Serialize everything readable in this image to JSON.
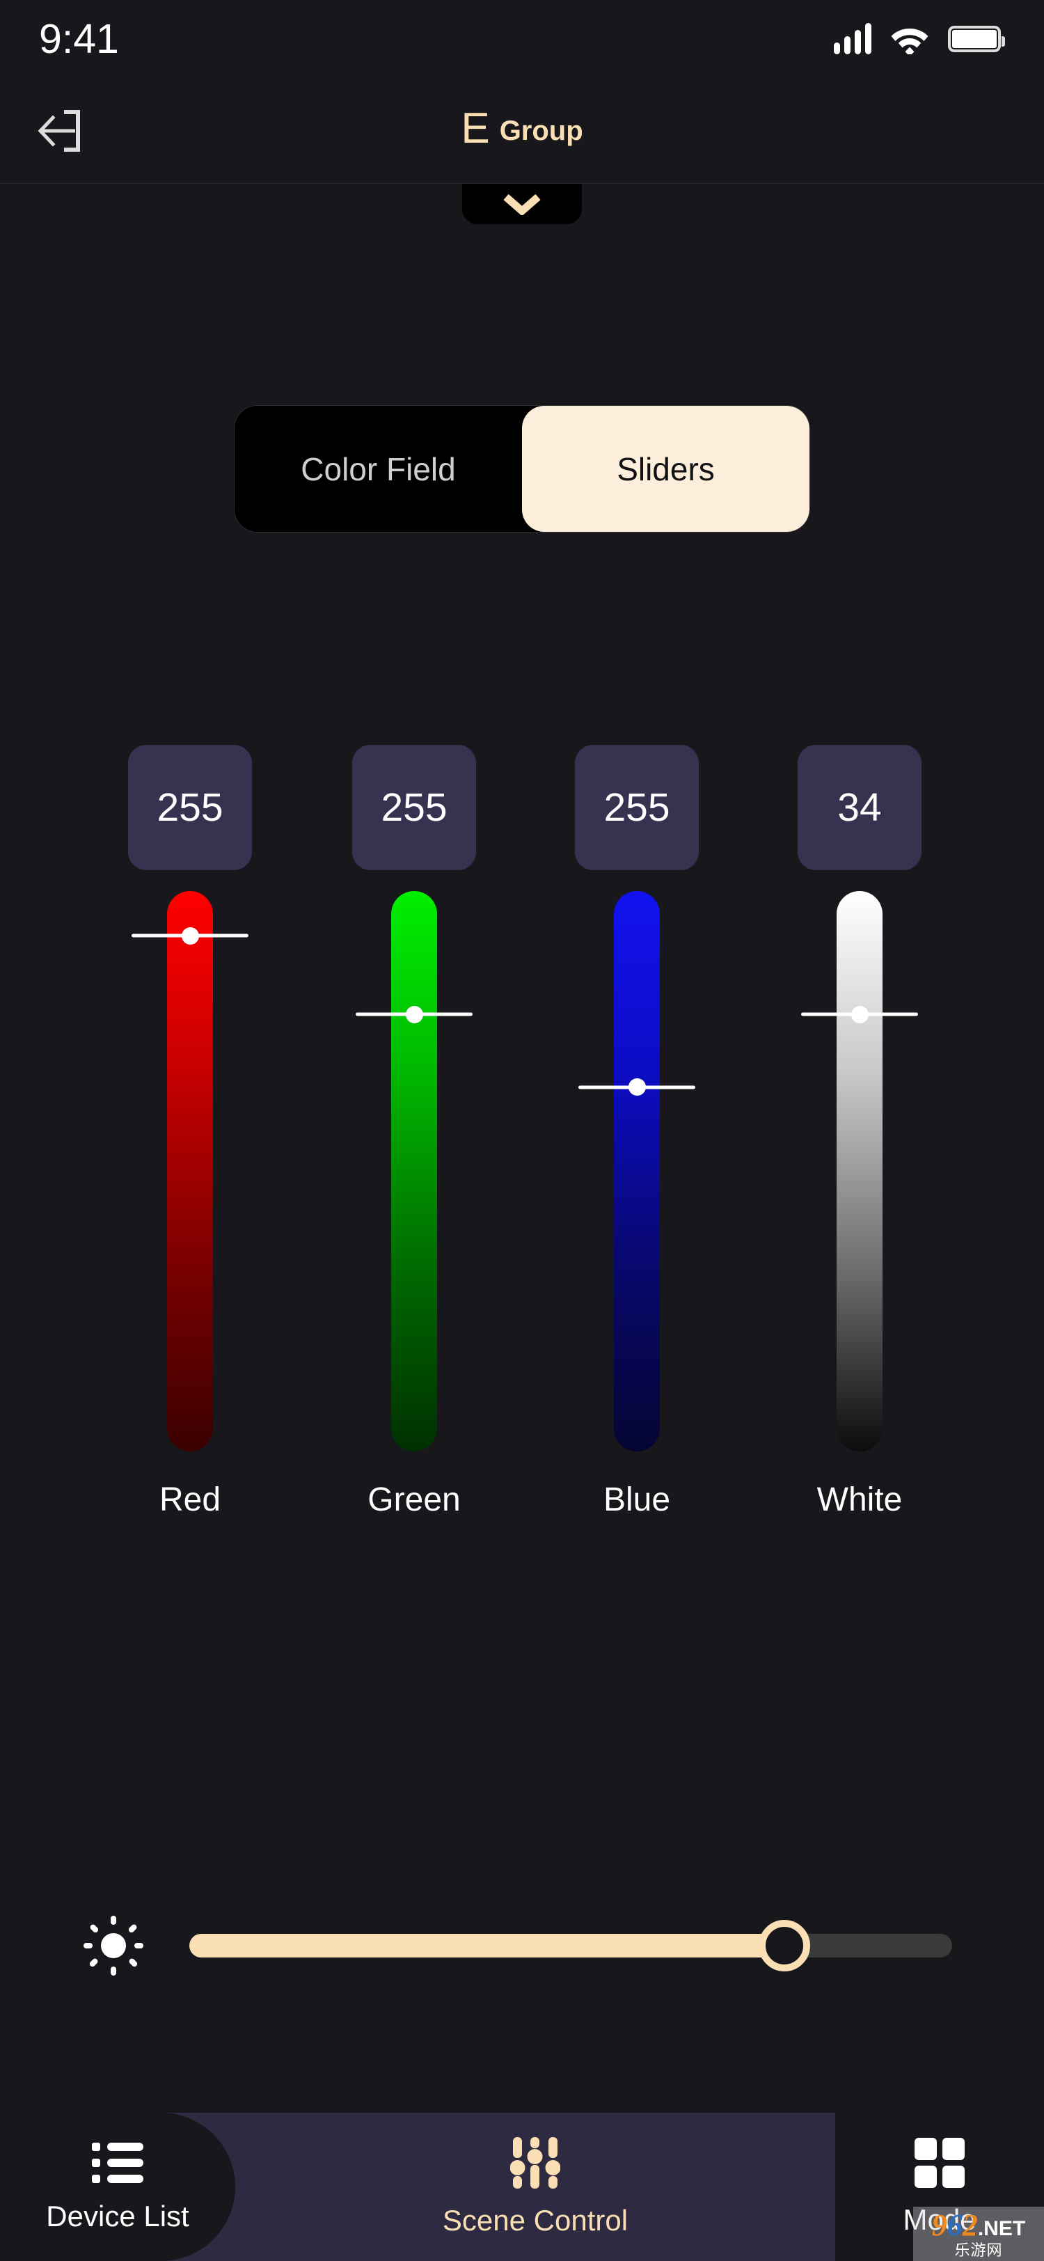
{
  "status_bar": {
    "time": "9:41",
    "signal_icon": "cellular-signal-icon",
    "wifi_icon": "wifi-icon",
    "battery_icon": "battery-full-icon"
  },
  "header": {
    "back_icon": "back-arrow-icon",
    "title_letter": "E",
    "title_text": "Group",
    "accent_color": "#f9dfb3"
  },
  "sheet_handle": {
    "icon": "chevron-down-icon"
  },
  "segmented_control": {
    "options": [
      {
        "label": "Color Field",
        "active": false
      },
      {
        "label": "Sliders",
        "active": true
      }
    ],
    "active_bg": "#fceeda",
    "inactive_bg": "#000000"
  },
  "channels": [
    {
      "name": "Red",
      "value": "255",
      "label": "Red",
      "color": "#ff0000",
      "thumb_percent": 8
    },
    {
      "name": "Green",
      "value": "255",
      "label": "Green",
      "color": "#00ef00",
      "thumb_percent": 22
    },
    {
      "name": "Blue",
      "value": "255",
      "label": "Blue",
      "color": "#1212f0",
      "thumb_percent": 35
    },
    {
      "name": "White",
      "value": "34",
      "label": "White",
      "color": "#ffffff",
      "thumb_percent": 22
    }
  ],
  "brightness": {
    "icon": "brightness-sun-icon",
    "percent": 78,
    "fill_color": "#fadfb4",
    "track_color": "#3a3a3a"
  },
  "bottom_nav": {
    "background": "#2e2a42",
    "items": [
      {
        "label": "Device List",
        "icon": "list-icon",
        "active": false
      },
      {
        "label": "Scene Control",
        "icon": "equalizer-icon",
        "active": true
      },
      {
        "label": "Mode",
        "icon": "grid-icon",
        "active": false
      }
    ]
  },
  "watermark": {
    "digit_9": "9",
    "digit_6": "6",
    "digit_2": "2",
    "net": ".NET",
    "chinese": "乐游网"
  }
}
